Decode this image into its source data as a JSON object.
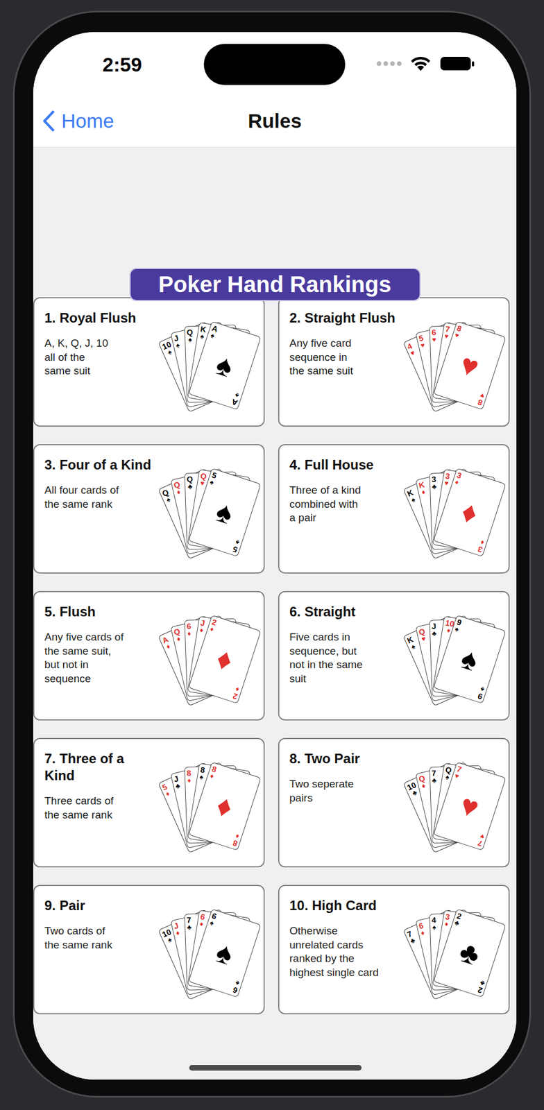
{
  "status_bar": {
    "time": "2:59"
  },
  "nav": {
    "back": "Home",
    "title": "Rules"
  },
  "poster": {
    "title": "Poker Hand Rankings"
  },
  "hands": [
    {
      "title": "1. Royal Flush",
      "lines": [
        "A, K, Q, J, 10",
        "all of the",
        "same suit"
      ],
      "cards": [
        {
          "rank": "10",
          "suit": "♠",
          "color": "#000000"
        },
        {
          "rank": "J",
          "suit": "♠",
          "color": "#000000"
        },
        {
          "rank": "Q",
          "suit": "♠",
          "color": "#000000"
        },
        {
          "rank": "K",
          "suit": "♠",
          "color": "#000000"
        },
        {
          "rank": "A",
          "suit": "♠",
          "color": "#000000"
        }
      ]
    },
    {
      "title": "2. Straight Flush",
      "lines": [
        "Any five card",
        "sequence in",
        "the same suit"
      ],
      "cards": [
        {
          "rank": "4",
          "suit": "♥",
          "color": "#e0302e"
        },
        {
          "rank": "5",
          "suit": "♥",
          "color": "#e0302e"
        },
        {
          "rank": "6",
          "suit": "♥",
          "color": "#e0302e"
        },
        {
          "rank": "7",
          "suit": "♥",
          "color": "#e0302e"
        },
        {
          "rank": "8",
          "suit": "♥",
          "color": "#e0302e"
        }
      ]
    },
    {
      "title": "3. Four of a Kind",
      "lines": [
        "All four cards of",
        "the same rank"
      ],
      "cards": [
        {
          "rank": "Q",
          "suit": "♠",
          "color": "#000000"
        },
        {
          "rank": "Q",
          "suit": "♦",
          "color": "#e0302e"
        },
        {
          "rank": "Q",
          "suit": "♣",
          "color": "#000000"
        },
        {
          "rank": "Q",
          "suit": "♥",
          "color": "#e0302e"
        },
        {
          "rank": "5",
          "suit": "♠",
          "color": "#000000"
        }
      ]
    },
    {
      "title": "4. Full House",
      "lines": [
        "Three of a kind",
        "combined with",
        "a pair"
      ],
      "cards": [
        {
          "rank": "K",
          "suit": "♠",
          "color": "#000000"
        },
        {
          "rank": "K",
          "suit": "♦",
          "color": "#e0302e"
        },
        {
          "rank": "3",
          "suit": "♣",
          "color": "#000000"
        },
        {
          "rank": "3",
          "suit": "♥",
          "color": "#e0302e"
        },
        {
          "rank": "3",
          "suit": "♦",
          "color": "#e0302e"
        }
      ]
    },
    {
      "title": "5. Flush",
      "lines": [
        "Any five cards of",
        "the same suit,",
        "but not in",
        "sequence"
      ],
      "cards": [
        {
          "rank": "A",
          "suit": "♦",
          "color": "#e0302e"
        },
        {
          "rank": "Q",
          "suit": "♦",
          "color": "#e0302e"
        },
        {
          "rank": "6",
          "suit": "♦",
          "color": "#e0302e"
        },
        {
          "rank": "J",
          "suit": "♦",
          "color": "#e0302e"
        },
        {
          "rank": "2",
          "suit": "♦",
          "color": "#e0302e"
        }
      ]
    },
    {
      "title": "6. Straight",
      "lines": [
        "Five cards in",
        "sequence, but",
        "not in the same",
        "suit"
      ],
      "cards": [
        {
          "rank": "K",
          "suit": "♠",
          "color": "#000000"
        },
        {
          "rank": "Q",
          "suit": "♥",
          "color": "#e0302e"
        },
        {
          "rank": "J",
          "suit": "♣",
          "color": "#000000"
        },
        {
          "rank": "10",
          "suit": "♦",
          "color": "#e0302e"
        },
        {
          "rank": "9",
          "suit": "♠",
          "color": "#000000"
        }
      ]
    },
    {
      "title": "7. Three of a Kind",
      "lines": [
        "Three cards of",
        "the same rank"
      ],
      "cards": [
        {
          "rank": "5",
          "suit": "♦",
          "color": "#e0302e"
        },
        {
          "rank": "J",
          "suit": "♣",
          "color": "#000000"
        },
        {
          "rank": "8",
          "suit": "♦",
          "color": "#e0302e"
        },
        {
          "rank": "8",
          "suit": "♠",
          "color": "#000000"
        },
        {
          "rank": "8",
          "suit": "♦",
          "color": "#e0302e"
        }
      ]
    },
    {
      "title": "8. Two Pair",
      "lines": [
        "Two seperate",
        "pairs"
      ],
      "cards": [
        {
          "rank": "10",
          "suit": "♣",
          "color": "#000000"
        },
        {
          "rank": "Q",
          "suit": "♦",
          "color": "#e0302e"
        },
        {
          "rank": "7",
          "suit": "♣",
          "color": "#000000"
        },
        {
          "rank": "Q",
          "suit": "♠",
          "color": "#000000"
        },
        {
          "rank": "7",
          "suit": "♥",
          "color": "#e0302e"
        }
      ]
    },
    {
      "title": "9. Pair",
      "lines": [
        "Two cards of",
        "the same rank"
      ],
      "cards": [
        {
          "rank": "10",
          "suit": "♠",
          "color": "#000000"
        },
        {
          "rank": "J",
          "suit": "♦",
          "color": "#e0302e"
        },
        {
          "rank": "7",
          "suit": "♣",
          "color": "#000000"
        },
        {
          "rank": "6",
          "suit": "♦",
          "color": "#e0302e"
        },
        {
          "rank": "6",
          "suit": "♠",
          "color": "#000000"
        }
      ]
    },
    {
      "title": "10. High Card",
      "lines": [
        "Otherwise",
        "unrelated cards",
        "ranked by the",
        "highest single card"
      ],
      "cards": [
        {
          "rank": "7",
          "suit": "♣",
          "color": "#000000"
        },
        {
          "rank": "6",
          "suit": "♦",
          "color": "#e0302e"
        },
        {
          "rank": "4",
          "suit": "♠",
          "color": "#000000"
        },
        {
          "rank": "3",
          "suit": "♦",
          "color": "#e0302e"
        },
        {
          "rank": "2",
          "suit": "♣",
          "color": "#000000"
        }
      ]
    }
  ]
}
